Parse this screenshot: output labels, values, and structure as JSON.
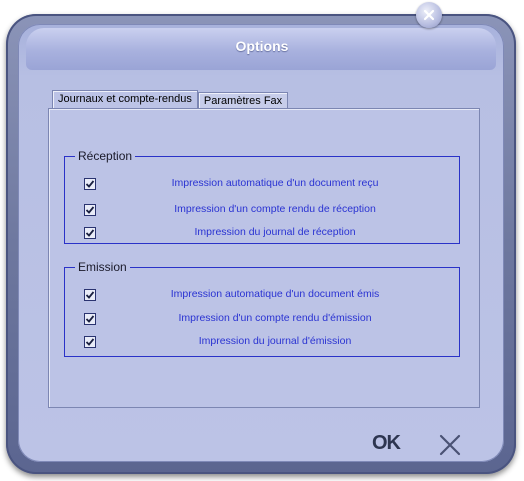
{
  "dialog": {
    "title": "Options"
  },
  "tabs": [
    {
      "label": "Journaux et compte-rendus",
      "active": true
    },
    {
      "label": "Paramètres Fax",
      "active": false
    }
  ],
  "reception": {
    "legend": "Réception",
    "items": [
      {
        "label": "Impression automatique d'un document reçu",
        "checked": true
      },
      {
        "label": "Impression  d'un compte rendu de réception",
        "checked": true
      },
      {
        "label": "Impression du journal de réception",
        "checked": true
      }
    ]
  },
  "emission": {
    "legend": "Emission",
    "items": [
      {
        "label": "Impression automatique d'un document émis",
        "checked": true
      },
      {
        "label": "Impression  d'un compte rendu d'émission",
        "checked": true
      },
      {
        "label": "Impression du journal d'émission",
        "checked": true
      }
    ]
  },
  "buttons": {
    "ok_label": "OK"
  },
  "colors": {
    "accent_text": "#2a33d2",
    "group_border": "#2a32c8",
    "frame": "#6e789f",
    "body": "#bcc3e6"
  }
}
